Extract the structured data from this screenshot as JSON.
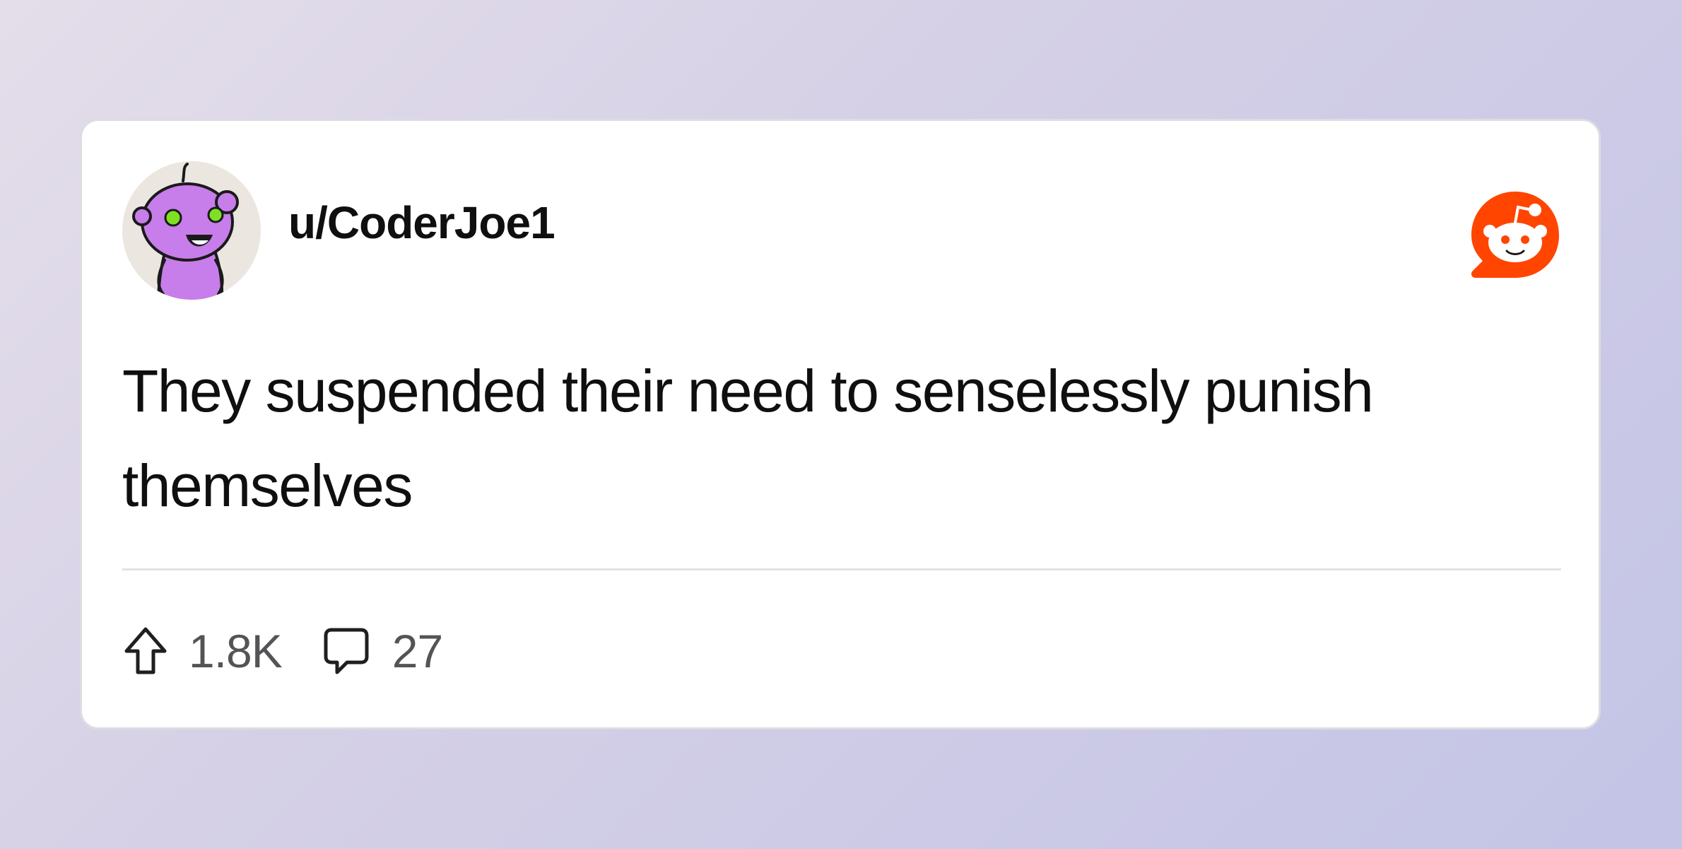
{
  "post": {
    "username": "u/CoderJoe1",
    "text": "They suspended their need to senselessly punish themselves",
    "upvotes": "1.8K",
    "comments": "27"
  },
  "icons": {
    "avatar": "snoo-avatar-icon",
    "brand": "reddit-logo-icon",
    "upvote": "upvote-arrow-icon",
    "comment": "comment-bubble-icon"
  },
  "colors": {
    "brand": "#ff4500",
    "avatar_body": "#c77dea",
    "avatar_eyes": "#7fe023",
    "text": "#0f0f0f",
    "muted": "#545456"
  }
}
